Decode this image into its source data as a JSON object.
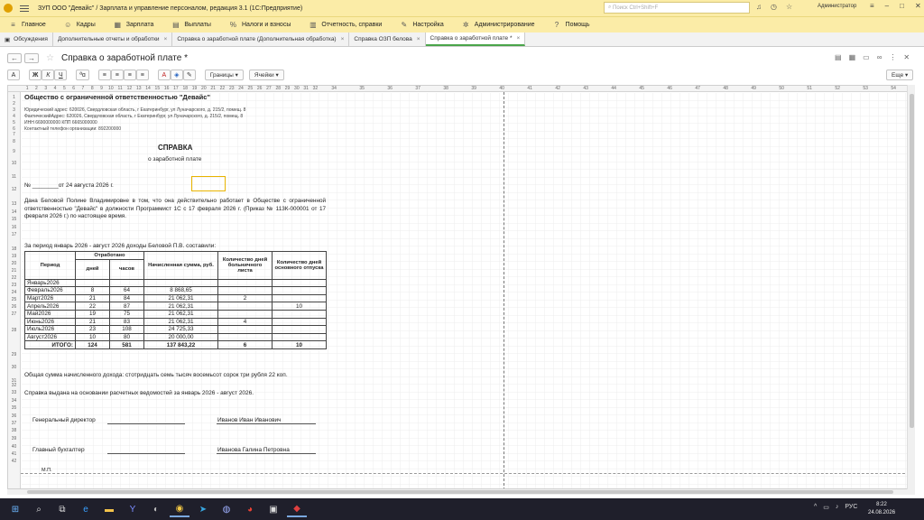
{
  "app": {
    "title": "ЗУП ООО \"Девайс\" / Зарплата и управление персоналом, редакция 3.1  (1С:Предприятие)",
    "search_placeholder": "Поиск Ctrl+Shift+F",
    "user": "Администратор"
  },
  "menu": [
    {
      "label": "Главное",
      "icon": "home-icon"
    },
    {
      "label": "Кадры",
      "icon": "people-icon"
    },
    {
      "label": "Зарплата",
      "icon": "calculator-icon"
    },
    {
      "label": "Выплаты",
      "icon": "payments-icon"
    },
    {
      "label": "Налоги и взносы",
      "icon": "percent-icon"
    },
    {
      "label": "Отчетность, справки",
      "icon": "report-icon"
    },
    {
      "label": "Настройка",
      "icon": "wrench-icon"
    },
    {
      "label": "Администрирование",
      "icon": "gear-icon"
    },
    {
      "label": "Помощь",
      "icon": "help-icon"
    }
  ],
  "tabs": [
    {
      "label": "Обсуждения"
    },
    {
      "label": "Дополнительные отчеты и обработки"
    },
    {
      "label": "Справка о заработной плате (Дополнительная обработка)"
    },
    {
      "label": "Справка ОЗП белова"
    },
    {
      "label": "Справка о заработной плате *"
    }
  ],
  "document": {
    "title": "Справка о заработной плате *"
  },
  "toolbar": {
    "bold": "Ж",
    "italic": "К",
    "underline": "Ч",
    "borders": "Границы",
    "cells": "Ячейки",
    "more": "Еще"
  },
  "sheet": {
    "org_name": "Общество с ограниченной ответственностью \"Девайс\"",
    "legal_address": "Юридический адрес: 620026, Свердловская область, г Екатеринбург, ул Луначарского, д. 215/2, помещ. 8",
    "actual_address": "ФактическийАдрес: 620026, Свердловская область, г Екатеринбург, ул Луначарского, д. 215/2, помещ. 8",
    "inn": "ИНН 6690000000 КПП 6665000000",
    "phone": "Контактный телефон организации: 892200000",
    "heading": "СПРАВКА",
    "subheading": "о заработной плате",
    "number_date": "№ ________от 24 августа 2026 г.",
    "body": "Дана Беловой Полине Владимировне в том, что она действительно работает в Обществе с ограниченной ответственностью \"Девайс\" в должности Программист 1С с 17 февраля 2026 г. (Приказ № 113К-000001 от 17 февраля 2026 г.) по настоящее время.",
    "period_text": "За период январь 2026 - август 2026 доходы Беловой П.В. составили:",
    "table_headers": {
      "period": "Период",
      "worked": "Отработано",
      "days": "дней",
      "hours": "часов",
      "sum": "Начисленная сумма, руб.",
      "sick": "Количество дней больничного листа",
      "vacation": "Количество дней основного отпуска"
    },
    "rows": [
      {
        "period": "Январь2026",
        "days": "",
        "hours": "",
        "sum": "",
        "sick": "",
        "vac": ""
      },
      {
        "period": "Февраль2026",
        "days": "8",
        "hours": "64",
        "sum": "8 868,65",
        "sick": "",
        "vac": ""
      },
      {
        "period": "Март2026",
        "days": "21",
        "hours": "84",
        "sum": "21 062,31",
        "sick": "2",
        "vac": ""
      },
      {
        "period": "Апрель2026",
        "days": "22",
        "hours": "87",
        "sum": "21 062,31",
        "sick": "",
        "vac": "10"
      },
      {
        "period": "Май2026",
        "days": "19",
        "hours": "75",
        "sum": "21 062,31",
        "sick": "",
        "vac": ""
      },
      {
        "period": "Июнь2026",
        "days": "21",
        "hours": "83",
        "sum": "21 062,31",
        "sick": "4",
        "vac": ""
      },
      {
        "period": "Июль2026",
        "days": "23",
        "hours": "108",
        "sum": "24 725,33",
        "sick": "",
        "vac": ""
      },
      {
        "period": "Август2026",
        "days": "10",
        "hours": "80",
        "sum": "20 000,00",
        "sick": "",
        "vac": ""
      }
    ],
    "total": {
      "label": "ИТОГО:",
      "days": "124",
      "hours": "581",
      "sum": "137 843,22",
      "sick": "6",
      "vac": "10"
    },
    "total_text": "Общая сумма начисленного дохода: стотридцать семь тысяч восемьсот сорок три рубля 22 коп.",
    "basis_text": "Справка выдана на основании расчетных ведомостей за январь 2026 - август 2026.",
    "director_label": "Генеральный директор",
    "director_name": "Иванов Иван Иванович",
    "accountant_label": "Главный бухгалтер",
    "accountant_name": "Иванова Галина Петровна",
    "stamp": "М.П."
  },
  "column_numbers": [
    "1",
    "2",
    "3",
    "4",
    "5",
    "6",
    "7",
    "8",
    "9",
    "10",
    "11",
    "12",
    "13",
    "14",
    "15",
    "16",
    "17",
    "18",
    "19",
    "20",
    "21",
    "22",
    "23",
    "24",
    "25",
    "26",
    "27",
    "28",
    "29",
    "30",
    "31",
    "32",
    "34",
    "35",
    "36",
    "37",
    "38",
    "39",
    "40",
    "41",
    "42",
    "43",
    "44",
    "45",
    "46",
    "47",
    "48",
    "49",
    "50",
    "51",
    "52",
    "53",
    "54"
  ],
  "row_numbers": [
    "1",
    "2",
    "3",
    "4",
    "5",
    "6",
    "7",
    "8",
    "9",
    "10",
    "11",
    "12",
    "13",
    "14",
    "15",
    "16",
    "17",
    "18",
    "19",
    "20",
    "21",
    "22",
    "23",
    "24",
    "25",
    "26",
    "27",
    "28",
    "29",
    "30",
    "31",
    "32",
    "33",
    "34",
    "35",
    "36",
    "37",
    "38",
    "39",
    "40",
    "41",
    "42"
  ],
  "taskbar": {
    "lang": "РУС",
    "time": "8:22",
    "date": "24.08.2026"
  }
}
